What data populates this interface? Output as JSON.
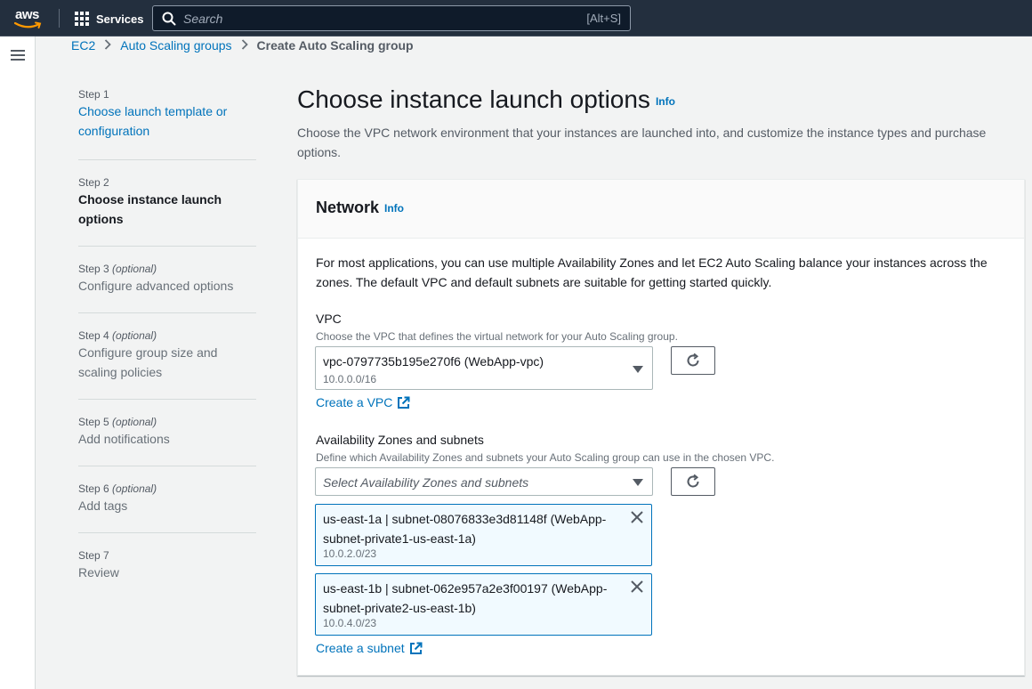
{
  "topnav": {
    "logo_text": "aws",
    "services_label": "Services",
    "search_placeholder": "Search",
    "search_shortcut": "[Alt+S]"
  },
  "breadcrumb": {
    "items": [
      "EC2",
      "Auto Scaling groups"
    ],
    "current": "Create Auto Scaling group"
  },
  "steps": [
    {
      "num": "Step 1",
      "optional": "",
      "title": "Choose launch template or configuration",
      "state": "link"
    },
    {
      "num": "Step 2",
      "optional": "",
      "title": "Choose instance launch options",
      "state": "active"
    },
    {
      "num": "Step 3",
      "optional": "(optional)",
      "title": "Configure advanced options",
      "state": "disabled"
    },
    {
      "num": "Step 4",
      "optional": "(optional)",
      "title": "Configure group size and scaling policies",
      "state": "disabled"
    },
    {
      "num": "Step 5",
      "optional": "(optional)",
      "title": "Add notifications",
      "state": "disabled"
    },
    {
      "num": "Step 6",
      "optional": "(optional)",
      "title": "Add tags",
      "state": "disabled"
    },
    {
      "num": "Step 7",
      "optional": "",
      "title": "Review",
      "state": "disabled"
    }
  ],
  "main": {
    "title": "Choose instance launch options",
    "info": "Info",
    "description": "Choose the VPC network environment that your instances are launched into, and customize the instance types and purchase options."
  },
  "network": {
    "heading": "Network",
    "info": "Info",
    "intro": "For most applications, you can use multiple Availability Zones and let EC2 Auto Scaling balance your instances across the zones. The default VPC and default subnets are suitable for getting started quickly.",
    "vpc": {
      "label": "VPC",
      "description": "Choose the VPC that defines the virtual network for your Auto Scaling group.",
      "value": "vpc-0797735b195e270f6 (WebApp-vpc)",
      "cidr": "10.0.0.0/16",
      "create_link": "Create a VPC"
    },
    "az": {
      "label": "Availability Zones and subnets",
      "description": "Define which Availability Zones and subnets your Auto Scaling group can use in the chosen VPC.",
      "placeholder": "Select Availability Zones and subnets",
      "tokens": [
        {
          "text": "us-east-1a | subnet-08076833e3d81148f (WebApp-subnet-private1-us-east-1a)",
          "cidr": "10.0.2.0/23"
        },
        {
          "text": "us-east-1b | subnet-062e957a2e3f00197 (WebApp-subnet-private2-us-east-1b)",
          "cidr": "10.0.4.0/23"
        }
      ],
      "create_link": "Create a subnet"
    }
  },
  "colors": {
    "nav_bg": "#232f3e",
    "link": "#0073bb",
    "token_bg": "#f1faff",
    "aws_orange": "#ff9900"
  }
}
